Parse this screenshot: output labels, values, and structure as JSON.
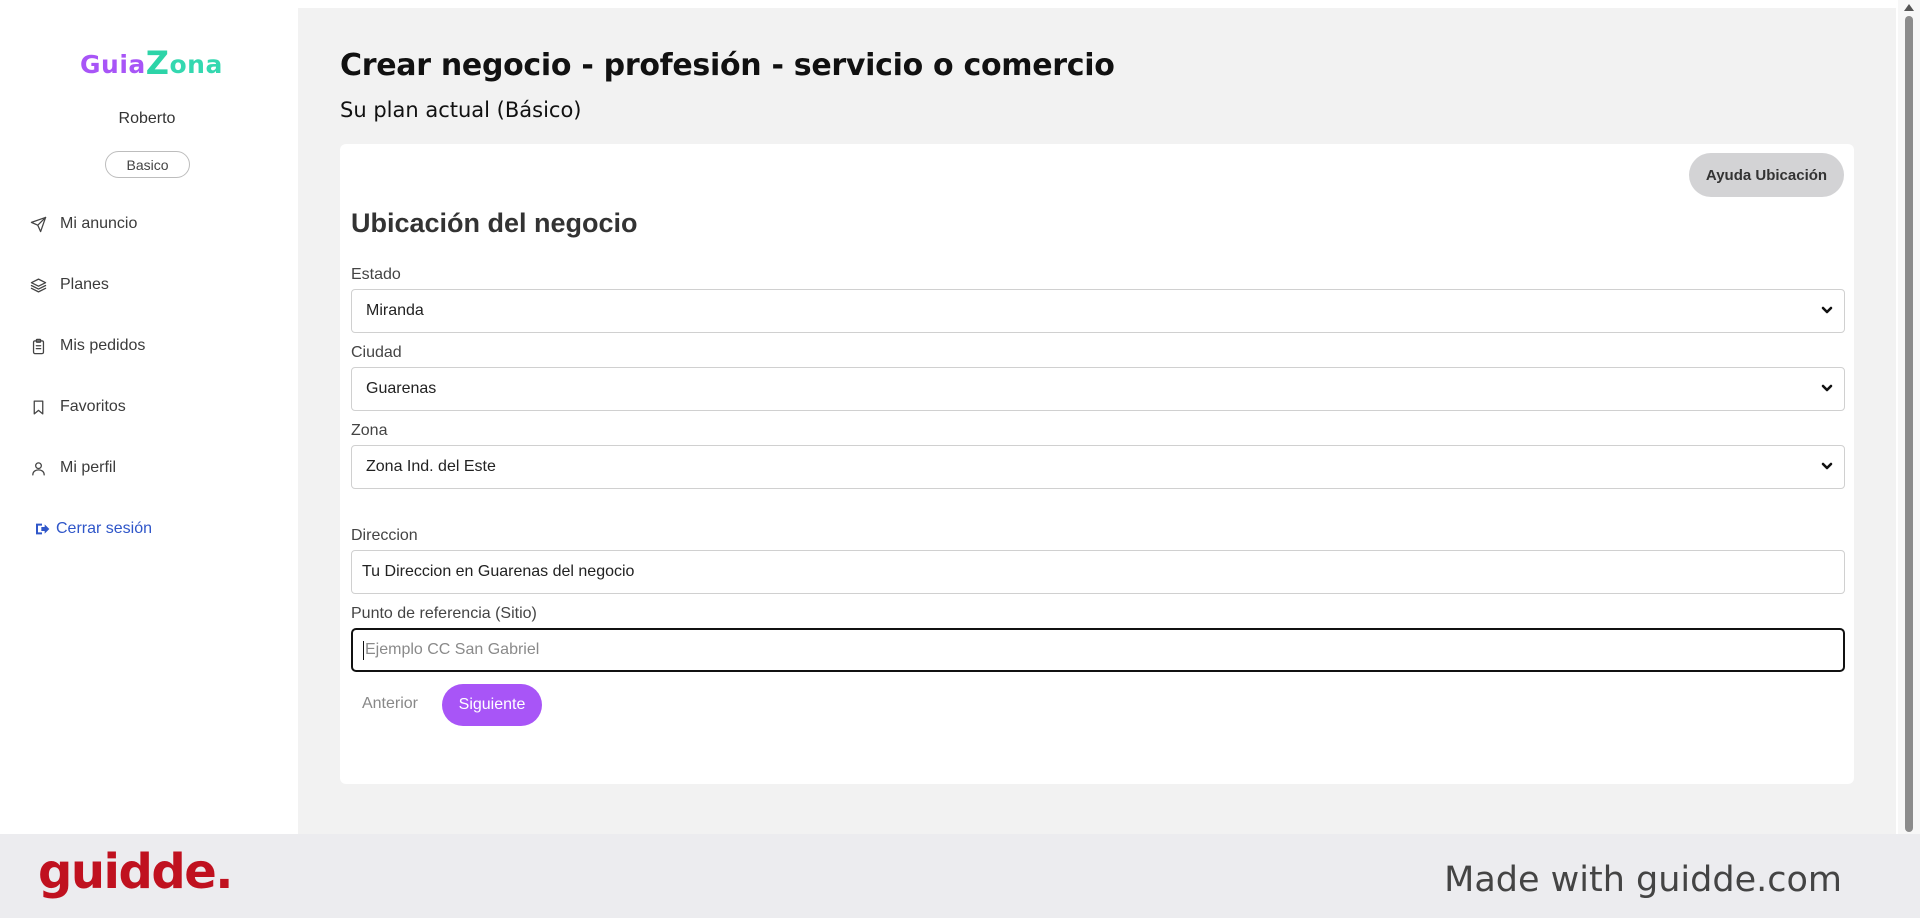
{
  "sidebar": {
    "logo": {
      "part1": "Guia",
      "part2": "Z",
      "part3": "ona"
    },
    "username": "Roberto",
    "plan_badge": "Basico",
    "nav": [
      {
        "label": "Mi anuncio",
        "icon": "send-icon"
      },
      {
        "label": "Planes",
        "icon": "layers-icon"
      },
      {
        "label": "Mis pedidos",
        "icon": "clipboard-icon"
      },
      {
        "label": "Favoritos",
        "icon": "bookmark-icon"
      },
      {
        "label": "Mi perfil",
        "icon": "user-icon"
      }
    ],
    "logout": {
      "label": "Cerrar sesión",
      "icon": "logout-icon",
      "color": "#2f56c9"
    }
  },
  "main": {
    "title": "Crear negocio - profesión - servicio o comercio",
    "plan_line": "Su plan actual (Básico)",
    "card": {
      "help_button": "Ayuda Ubicación",
      "section_title": "Ubicación del negocio",
      "estado": {
        "label": "Estado",
        "value": "Miranda"
      },
      "ciudad": {
        "label": "Ciudad",
        "value": "Guarenas"
      },
      "zona": {
        "label": "Zona",
        "value": "Zona Ind. del Este"
      },
      "direccion": {
        "label": "Direccion",
        "value": "Tu Direccion en Guarenas del negocio"
      },
      "punto_referencia": {
        "label": "Punto de referencia (Sitio)",
        "placeholder": "Ejemplo CC San Gabriel",
        "value": ""
      },
      "prev_button": "Anterior",
      "next_button": "Siguiente"
    }
  },
  "footer": {
    "brand": "guidde.",
    "made_with": "Made with guidde.com"
  },
  "colors": {
    "accent": "#a855f7",
    "logo_purple": "#a855f7",
    "logo_teal": "#2dd4a8",
    "footer_brand": "#c0111f",
    "help_button_bg": "#d3d3d5"
  }
}
